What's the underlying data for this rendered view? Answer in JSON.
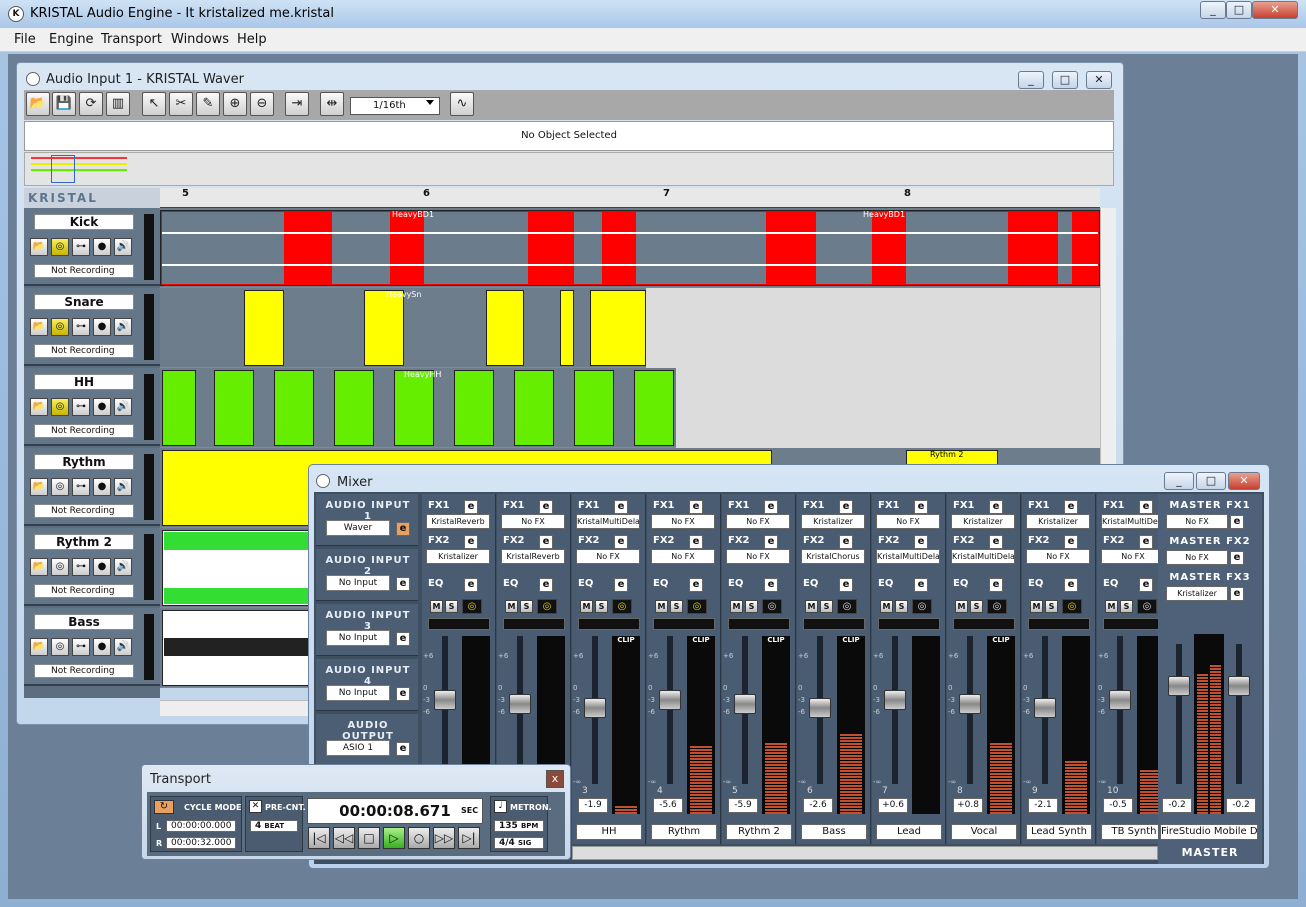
{
  "app": {
    "title": "KRISTAL Audio Engine - It kristalized me.kristal",
    "menu": [
      "File",
      "Engine",
      "Transport",
      "Windows",
      "Help"
    ]
  },
  "waver": {
    "title": "Audio Input 1 - KRISTAL Waver",
    "snap": "1/16th",
    "status": "No Object Selected",
    "logo": "KRISTAL WAVER",
    "ruler": [
      "5",
      "6",
      "7",
      "8"
    ],
    "tracks": [
      {
        "name": "Kick",
        "recording": "Not Recording",
        "clip_label": "HeavyBD1",
        "color": "#ff0000"
      },
      {
        "name": "Snare",
        "recording": "Not Recording",
        "clip_label": "HeavySn",
        "color": "#ffff00"
      },
      {
        "name": "HH",
        "recording": "Not Recording",
        "clip_label": "HeavyHH",
        "color": "#66ee00"
      },
      {
        "name": "Rythm",
        "recording": "Not Recording",
        "clip_label": "Rythm 2",
        "color": "#ffff00"
      },
      {
        "name": "Rythm 2",
        "recording": "Not Recording",
        "clip_label": "",
        "color": "#44dd44"
      },
      {
        "name": "Bass",
        "recording": "Not Recording",
        "clip_label": "",
        "color": "#ffffff"
      }
    ]
  },
  "mixer": {
    "title": "Mixer",
    "inputs": [
      {
        "label": "AUDIO INPUT 1",
        "value": "Waver"
      },
      {
        "label": "AUDIO INPUT 2",
        "value": "No Input"
      },
      {
        "label": "AUDIO INPUT 3",
        "value": "No Input"
      },
      {
        "label": "AUDIO INPUT 4",
        "value": "No Input"
      },
      {
        "label": "AUDIO OUTPUT",
        "value": "ASIO 1"
      }
    ],
    "labels": {
      "fx1": "FX1",
      "fx2": "FX2",
      "eq": "EQ",
      "m": "M",
      "s": "S",
      "e": "e",
      "clip": "CLIP",
      "scale": [
        "+6",
        "0",
        "-3",
        "-6",
        "-∞"
      ]
    },
    "channels": [
      {
        "fx1": "KristalReverb",
        "fx2": "Kristalizer",
        "num": "1",
        "val": "",
        "name": "",
        "level": 0,
        "rec": true
      },
      {
        "fx1": "No FX",
        "fx2": "KristalReverb",
        "num": "2",
        "val": "",
        "name": "",
        "level": 0.08,
        "rec": true
      },
      {
        "fx1": "KristalMultiDelay",
        "fx2": "No FX",
        "num": "3",
        "val": "-1.9",
        "name": "HH",
        "level": 0.05,
        "rec": true
      },
      {
        "fx1": "No FX",
        "fx2": "No FX",
        "num": "4",
        "val": "-5.6",
        "name": "Rythm",
        "level": 0.38,
        "rec": true
      },
      {
        "fx1": "No FX",
        "fx2": "No FX",
        "num": "5",
        "val": "-5.9",
        "name": "Rythm 2",
        "level": 0.4,
        "rec": false
      },
      {
        "fx1": "Kristalizer",
        "fx2": "KristalChorus",
        "num": "6",
        "val": "-2.6",
        "name": "Bass",
        "level": 0.45,
        "rec": false
      },
      {
        "fx1": "No FX",
        "fx2": "KristalMultiDelay",
        "num": "7",
        "val": "+0.6",
        "name": "Lead",
        "level": 0,
        "rec": false
      },
      {
        "fx1": "Kristalizer",
        "fx2": "KristalMultiDelay",
        "num": "8",
        "val": "+0.8",
        "name": "Vocal",
        "level": 0.4,
        "rec": false
      },
      {
        "fx1": "Kristalizer",
        "fx2": "No FX",
        "num": "9",
        "val": "-2.1",
        "name": "Lead Synth",
        "level": 0.3,
        "rec": true
      },
      {
        "fx1": "KristalMultiDelay",
        "fx2": "No FX",
        "num": "10",
        "val": "-0.5",
        "name": "TB Synth",
        "level": 0.25,
        "rec": false
      }
    ],
    "master": {
      "fx1_label": "MASTER FX1",
      "fx1": "No FX",
      "fx2_label": "MASTER FX2",
      "fx2": "No FX",
      "fx3_label": "MASTER FX3",
      "fx3": "Kristalizer",
      "val_l": "-0.2",
      "val_r": "-0.2",
      "device": "FireStudio Mobile D...",
      "label": "MASTER"
    }
  },
  "transport": {
    "title": "Transport",
    "cycle_label": "CYCLE MODE",
    "left": "00:00:00.000",
    "right": "00:00:32.000",
    "l": "L",
    "r": "R",
    "precnt_label": "PRE-CNT.",
    "precnt": "4",
    "beat": "BEAT",
    "time": "00:00:08.671",
    "sec": "SEC",
    "metro_label": "METRON.",
    "bpm": "135",
    "bpm_label": "BPM",
    "sig": "4/4",
    "sig_label": "SIG",
    "close": "x"
  }
}
